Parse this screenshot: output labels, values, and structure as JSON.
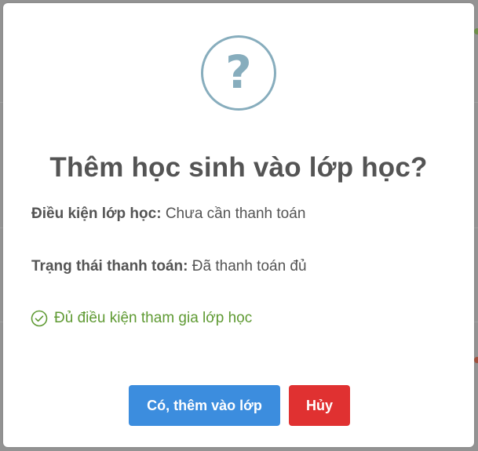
{
  "dialog": {
    "icon": "question-mark-icon",
    "icon_glyph": "?",
    "title": "Thêm học sinh vào lớp học?",
    "condition": {
      "label": "Điều kiện lớp học:",
      "value": "Chưa cần thanh toán"
    },
    "payment_status": {
      "label": "Trạng thái thanh toán:",
      "value": "Đã thanh toán đủ"
    },
    "eligibility_message": "Đủ điều kiện tham gia lớp học",
    "confirm_label": "Có, thêm vào lớp",
    "cancel_label": "Hủy"
  },
  "colors": {
    "icon": "#87adbd",
    "success": "#5f9a33",
    "confirm": "#3c8dde",
    "cancel": "#e03131",
    "text": "#545454"
  }
}
